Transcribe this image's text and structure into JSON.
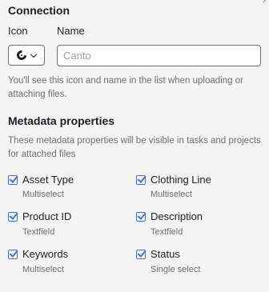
{
  "connection": {
    "title": "Connection",
    "icon_label": "Icon",
    "name_label": "Name",
    "name_placeholder": "Canto",
    "name_value": "",
    "icon_selected": "canto-logo-icon",
    "help": "You'll see this icon and name in the list when uploading or attaching files."
  },
  "metadata": {
    "title": "Metadata properties",
    "description": "These metadata properties will be visible in tasks and projects for attached files",
    "properties": [
      {
        "name": "Asset Type",
        "type": "Multiselect",
        "checked": true
      },
      {
        "name": "Clothing Line",
        "type": "Multiselect",
        "checked": true
      },
      {
        "name": "Product ID",
        "type": "Textfield",
        "checked": true
      },
      {
        "name": "Description",
        "type": "Textfield",
        "checked": true
      },
      {
        "name": "Keywords",
        "type": "Multiselect",
        "checked": true
      },
      {
        "name": "Status",
        "type": "Single select",
        "checked": true
      }
    ]
  },
  "colors": {
    "accent": "#4573d2",
    "background": "#f4f4f4",
    "text": "#1e1f21",
    "muted": "#6d6e6f"
  }
}
